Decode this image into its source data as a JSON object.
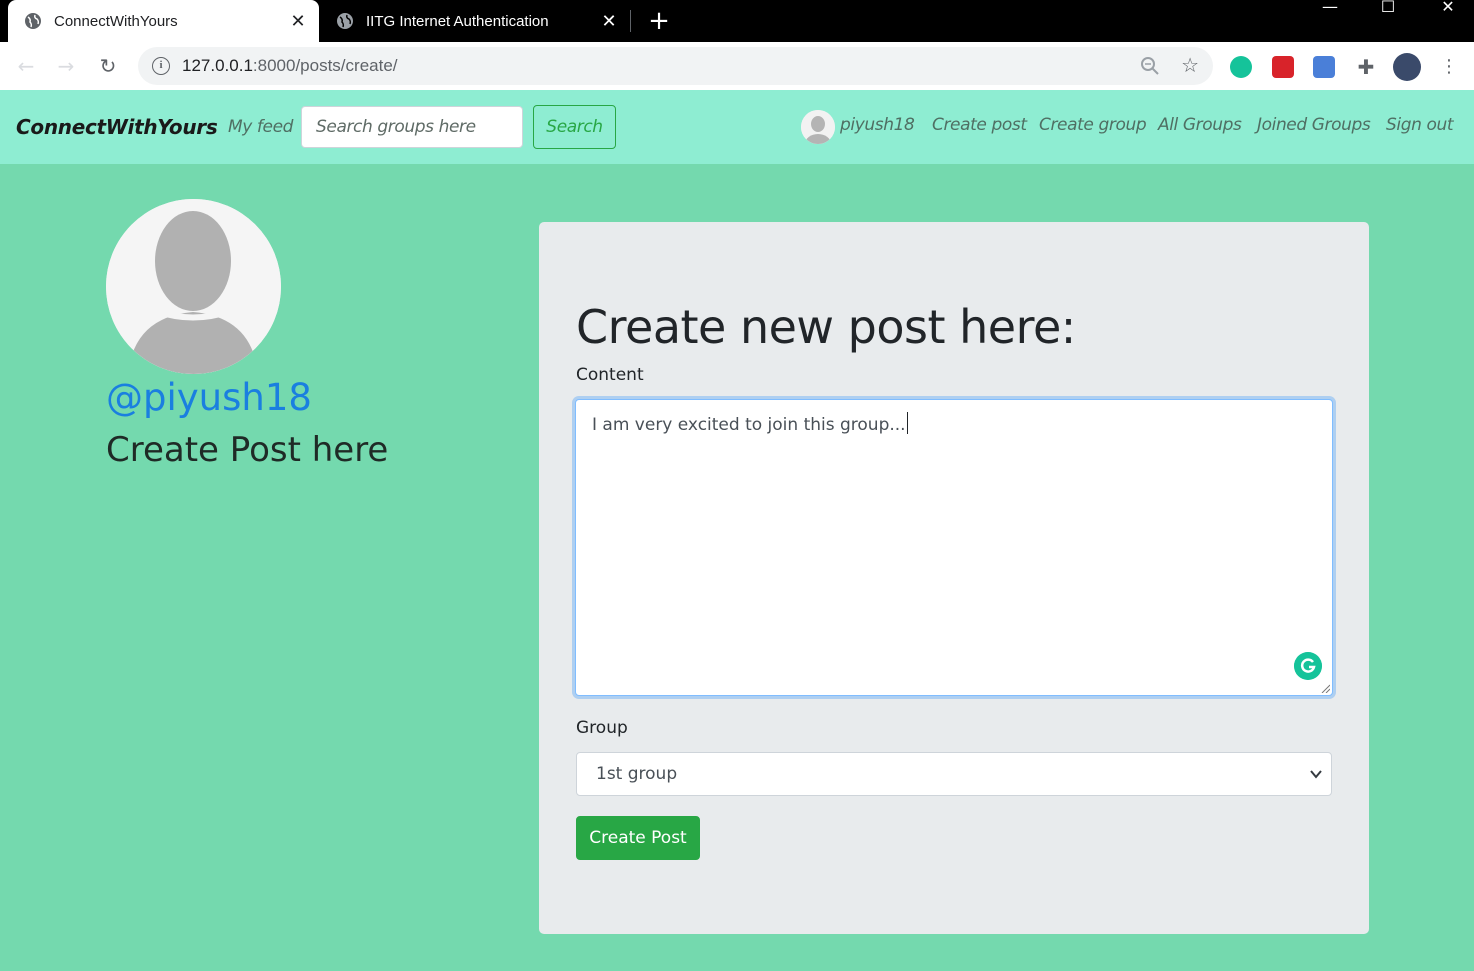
{
  "browser": {
    "tabs": [
      {
        "title": "ConnectWithYours",
        "active": true
      },
      {
        "title": "IITG Internet Authentication",
        "active": false
      }
    ],
    "new_tab_glyph": "+",
    "close_glyph": "✕",
    "url_host": "127.0.0.1",
    "url_path": ":8000/posts/create/",
    "window_controls": {
      "minimize": "—",
      "maximize": "☐",
      "close": "✕"
    },
    "extensions": [
      "grammarly-icon",
      "pdf-tool-icon",
      "camera-icon",
      "puzzle-extensions-icon",
      "profile-avatar-icon"
    ]
  },
  "navbar": {
    "brand": "ConnectWithYours",
    "my_feed": "My feed",
    "search_placeholder": "Search groups here",
    "search_button": "Search",
    "username": "piyush18",
    "links": {
      "create_post": "Create post",
      "create_group": "Create group",
      "all_groups": "All Groups",
      "joined_groups": "Joined Groups",
      "sign_out": "Sign out"
    }
  },
  "profile": {
    "handle": "@piyush18",
    "subheading": "Create Post here"
  },
  "form": {
    "heading": "Create new post here:",
    "content_label": "Content",
    "content_value": "I am very excited to join this group...",
    "group_label": "Group",
    "group_selected": "1st group",
    "submit_label": "Create Post"
  },
  "colors": {
    "page_bg": "#74d9ae",
    "navbar_bg": "#8eedd2",
    "card_bg": "#e8ebed",
    "success": "#28a745",
    "handle_blue": "#1a7fe0"
  }
}
